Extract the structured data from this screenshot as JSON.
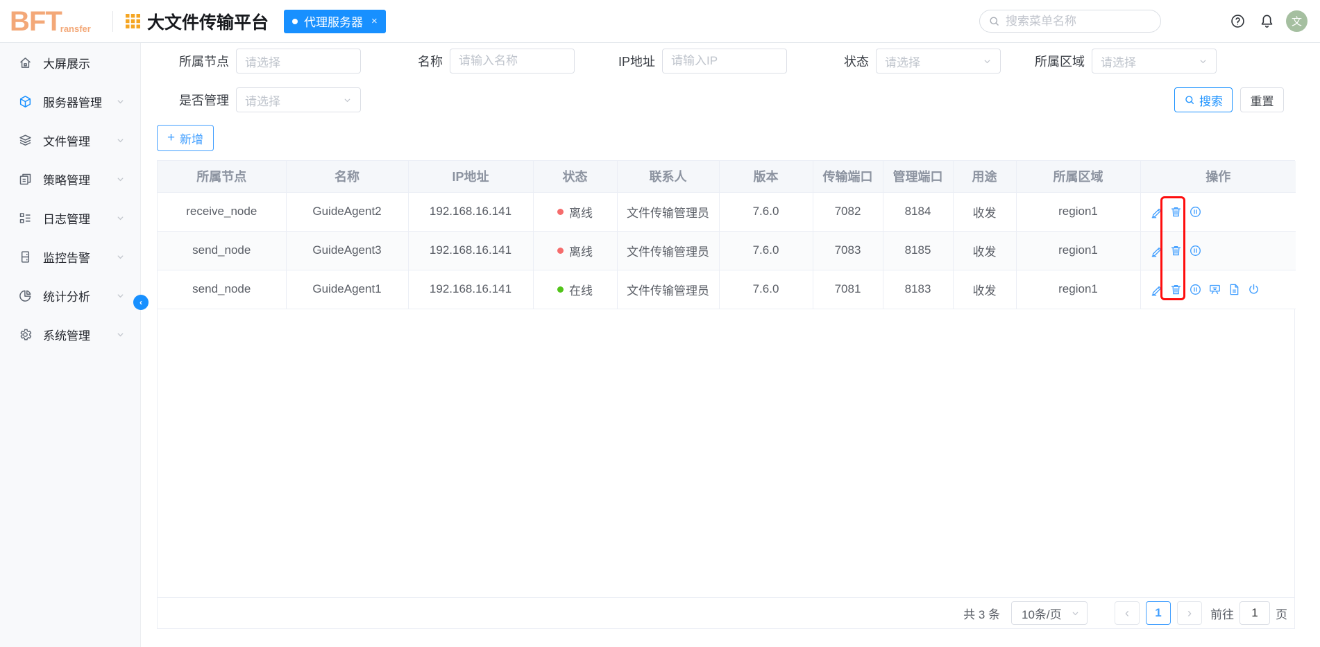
{
  "header": {
    "logo_main": "BFT",
    "logo_sub": "ransfer",
    "app_title": "大文件传输平台",
    "tab_label": "代理服务器",
    "tab_close": "×",
    "search_placeholder": "搜索菜单名称",
    "avatar_text": "文",
    "icons": [
      "help-icon",
      "bell-icon"
    ]
  },
  "sidebar": {
    "items": [
      {
        "label": "大屏展示",
        "icon": "home-icon"
      },
      {
        "label": "服务器管理",
        "icon": "server-cube-icon"
      },
      {
        "label": "文件管理",
        "icon": "files-layers-icon"
      },
      {
        "label": "策略管理",
        "icon": "policy-doc-icon"
      },
      {
        "label": "日志管理",
        "icon": "log-list-icon"
      },
      {
        "label": "监控告警",
        "icon": "monitor-alert-icon"
      },
      {
        "label": "统计分析",
        "icon": "stats-pie-icon"
      },
      {
        "label": "系统管理",
        "icon": "system-gear-icon"
      }
    ],
    "active_item": "服务器管理",
    "collapse_arrow": "‹"
  },
  "filters": {
    "node_label": "所属节点",
    "node_placeholder": "请选择",
    "name_label": "名称",
    "name_placeholder": "请输入名称",
    "ip_label": "IP地址",
    "ip_placeholder": "请输入IP",
    "status_label": "状态",
    "status_placeholder": "请选择",
    "region_label": "所属区域",
    "region_placeholder": "请选择",
    "managed_label": "是否管理",
    "managed_placeholder": "请选择",
    "search_button": "搜索",
    "reset_button": "重置",
    "add_button": "新增",
    "add_plus": "+"
  },
  "table": {
    "headers": [
      "所属节点",
      "名称",
      "IP地址",
      "状态",
      "联系人",
      "版本",
      "传输端口",
      "管理端口",
      "用途",
      "所属区域",
      "操作"
    ],
    "rows": [
      {
        "node": "receive_node",
        "name": "GuideAgent2",
        "ip": "192.168.16.141",
        "status": "离线",
        "status_color": "#f56c6c",
        "contact": "文件传输管理员",
        "version": "7.6.0",
        "transfer_port": "7082",
        "manage_port": "8184",
        "usage": "收发",
        "region": "region1",
        "actions": [
          "edit-icon",
          "delete-icon",
          "pause-icon"
        ]
      },
      {
        "node": "send_node",
        "name": "GuideAgent3",
        "ip": "192.168.16.141",
        "status": "离线",
        "status_color": "#f56c6c",
        "contact": "文件传输管理员",
        "version": "7.6.0",
        "transfer_port": "7083",
        "manage_port": "8185",
        "usage": "收发",
        "region": "region1",
        "actions": [
          "edit-icon",
          "delete-icon",
          "pause-icon"
        ]
      },
      {
        "node": "send_node",
        "name": "GuideAgent1",
        "ip": "192.168.16.141",
        "status": "在线",
        "status_color": "#52c41a",
        "contact": "文件传输管理员",
        "version": "7.6.0",
        "transfer_port": "7081",
        "manage_port": "8183",
        "usage": "收发",
        "region": "region1",
        "actions": [
          "edit-icon",
          "delete-icon",
          "pause-icon",
          "screen-icon",
          "document-icon",
          "power-icon"
        ]
      }
    ]
  },
  "pagination": {
    "total_text": "共 3 条",
    "page_size": "10条/页",
    "prev": "‹",
    "next": "›",
    "current_page": "1",
    "goto_label": "前往",
    "goto_value": "1",
    "page_unit": "页"
  },
  "annotation": {
    "highlighted": "delete-icon-column",
    "highlight_color": "#fe0d0d"
  },
  "colors": {
    "accent_blue": "#1890ff",
    "icon_blue": "#409eff",
    "online_green": "#52c41a",
    "offline_red": "#f56c6c",
    "logo_orange": "#f3a878",
    "grid_orange": "#f5a623",
    "avatar_green": "#a5bfa0"
  }
}
